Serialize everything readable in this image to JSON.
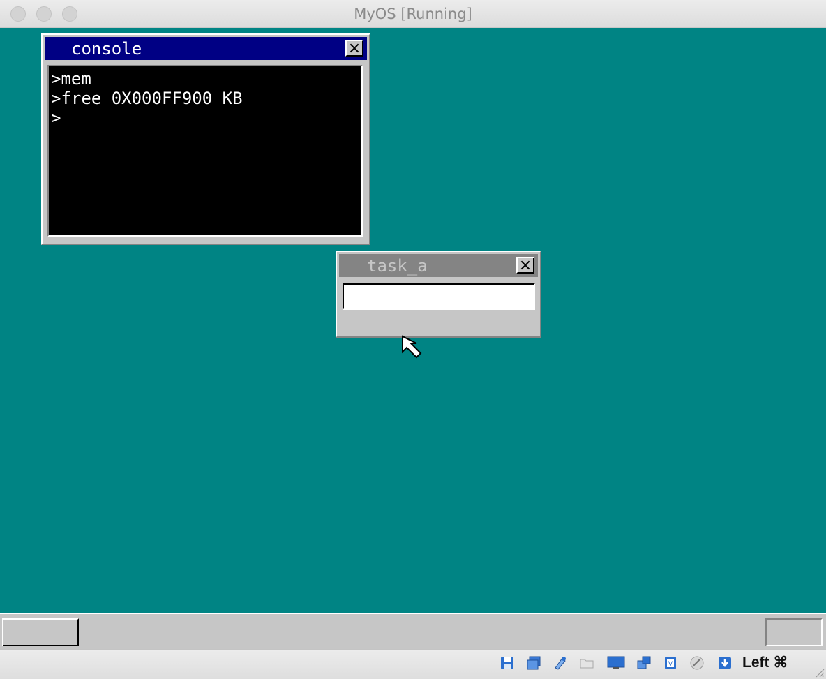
{
  "window": {
    "title": "MyOS [Running]"
  },
  "console": {
    "title": "console",
    "lines": [
      ">mem",
      ">free 0X000FF900 KB",
      ">"
    ]
  },
  "task_a": {
    "title": "task_a",
    "input_value": ""
  },
  "statusbar": {
    "host_key": "Left ⌘"
  },
  "colors": {
    "desktop": "#008484",
    "active_title": "#000084",
    "inactive_title": "#848484",
    "window_face": "#c6c6c6"
  },
  "icons": [
    "close-traffic-icon",
    "minimize-traffic-icon",
    "zoom-traffic-icon",
    "close-icon",
    "mouse-cursor-icon",
    "floppy-disk-icon",
    "optical-drive-icon",
    "usb-icon",
    "shared-folder-icon",
    "display-icon",
    "network-icon",
    "cpu-icon",
    "mouse-integration-icon",
    "keyboard-capture-icon",
    "resize-grip-icon"
  ]
}
